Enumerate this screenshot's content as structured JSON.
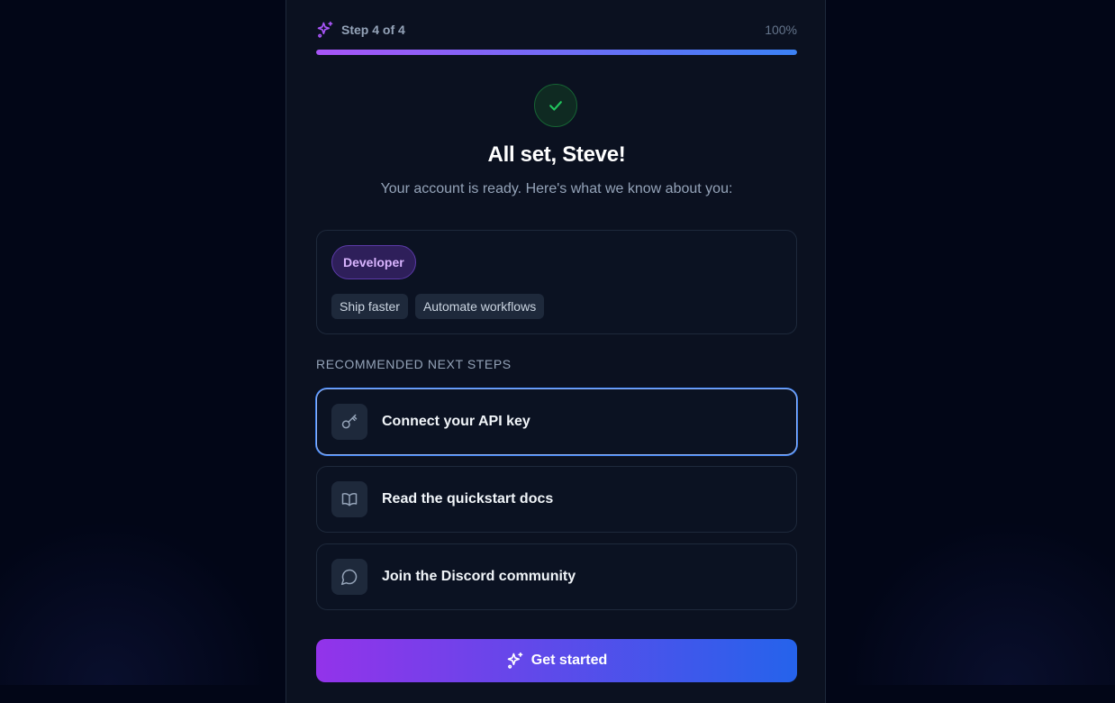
{
  "progress": {
    "step_label": "Step 4 of 4",
    "percent_label": "100%",
    "fraction": 1.0
  },
  "hero": {
    "title": "All set, Steve!",
    "subtitle": "Your account is ready. Here's what we know about you:"
  },
  "profile": {
    "role": "Developer",
    "goals": [
      "Ship faster",
      "Automate workflows"
    ]
  },
  "recommended": {
    "label": "RECOMMENDED NEXT STEPS",
    "items": [
      {
        "label": "Connect your API key",
        "icon": "key-icon"
      },
      {
        "label": "Read the quickstart docs",
        "icon": "book-icon"
      },
      {
        "label": "Join the Discord community",
        "icon": "chat-bubble-icon"
      }
    ]
  },
  "cta": {
    "label": "Get started"
  },
  "colors": {
    "accent_start": "#9333ea",
    "accent_end": "#2563eb",
    "success": "#22c55e",
    "background": "#020617"
  }
}
